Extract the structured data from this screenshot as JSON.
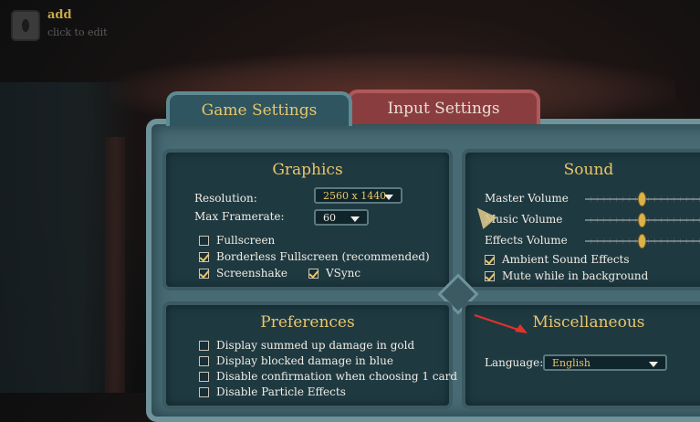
{
  "top_widget": {
    "title": "add",
    "subtitle": "click to edit"
  },
  "tabs": {
    "game": "Game Settings",
    "input": "Input Settings"
  },
  "graphics": {
    "title": "Graphics",
    "resolution_label": "Resolution:",
    "resolution_value": "2560 x 1440",
    "framerate_label": "Max Framerate:",
    "framerate_value": "60",
    "fullscreen": "Fullscreen",
    "borderless": "Borderless Fullscreen (recommended)",
    "screenshake": "Screenshake",
    "vsync": "VSync",
    "checked": {
      "fullscreen": false,
      "borderless": true,
      "screenshake": true,
      "vsync": true
    }
  },
  "sound": {
    "title": "Sound",
    "master": "Master Volume",
    "music": "Music Volume",
    "effects": "Effects Volume",
    "ambient": "Ambient Sound Effects",
    "mute_bg": "Mute while in background",
    "checked": {
      "ambient": true,
      "mute_bg": true
    },
    "levels": {
      "master": 0.5,
      "music": 0.5,
      "effects": 0.5
    }
  },
  "preferences": {
    "title": "Preferences",
    "summed_damage": "Display summed up damage in gold",
    "blocked_damage": "Display blocked damage in blue",
    "disable_confirm": "Disable confirmation when choosing 1 card",
    "particle": "Disable Particle Effects"
  },
  "misc": {
    "title": "Miscellaneous",
    "language_label": "Language:",
    "language_value": "English"
  },
  "colors": {
    "gold": "#e9c66a",
    "panel": "#476a73",
    "tab_input": "#8a3d3f"
  }
}
